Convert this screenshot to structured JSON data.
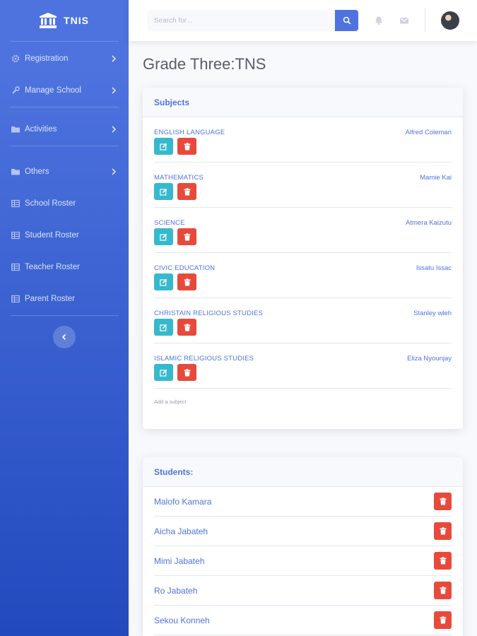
{
  "brand": {
    "name": "TNIS",
    "icon": "university-icon"
  },
  "sidebar": {
    "items": [
      {
        "label": "Registration",
        "icon": "gear-icon",
        "chevron": true
      },
      {
        "label": "Manage School",
        "icon": "wrench-icon",
        "chevron": true
      },
      {
        "label": "Activities",
        "icon": "folder-icon",
        "chevron": true
      },
      {
        "label": "Others",
        "icon": "folder-icon",
        "chevron": true
      },
      {
        "label": "School Roster",
        "icon": "table-icon",
        "chevron": false
      },
      {
        "label": "Student Roster",
        "icon": "table-icon",
        "chevron": false
      },
      {
        "label": "Teacher Roster",
        "icon": "table-icon",
        "chevron": false
      },
      {
        "label": "Parent Roster",
        "icon": "table-icon",
        "chevron": false
      }
    ]
  },
  "topbar": {
    "search_placeholder": "Search for..."
  },
  "page": {
    "title": "Grade Three:TNS"
  },
  "subjects_card": {
    "header": "Subjects",
    "items": [
      {
        "name": "English Language",
        "teacher": "Alfred Coleman"
      },
      {
        "name": "Mathematics",
        "teacher": "Mamie Kai"
      },
      {
        "name": "Science",
        "teacher": "Atmera Kaizutu"
      },
      {
        "name": "Civic Education",
        "teacher": "Issatu Issac"
      },
      {
        "name": "Christain Religious Studies",
        "teacher": "Stanley wleh"
      },
      {
        "name": "Islamic Religious Studies",
        "teacher": "Eliza Nyounjay"
      }
    ],
    "add_label": "Add a subject"
  },
  "students_card": {
    "header": "Students:",
    "items": [
      {
        "name": "Malofo Kamara"
      },
      {
        "name": "Aicha Jabateh"
      },
      {
        "name": "Mimi Jabateh"
      },
      {
        "name": "Ro Jabateh"
      },
      {
        "name": "Sekou Konneh"
      }
    ]
  },
  "colors": {
    "primary": "#4e73df",
    "info": "#36b9cc",
    "danger": "#e74a3b"
  }
}
